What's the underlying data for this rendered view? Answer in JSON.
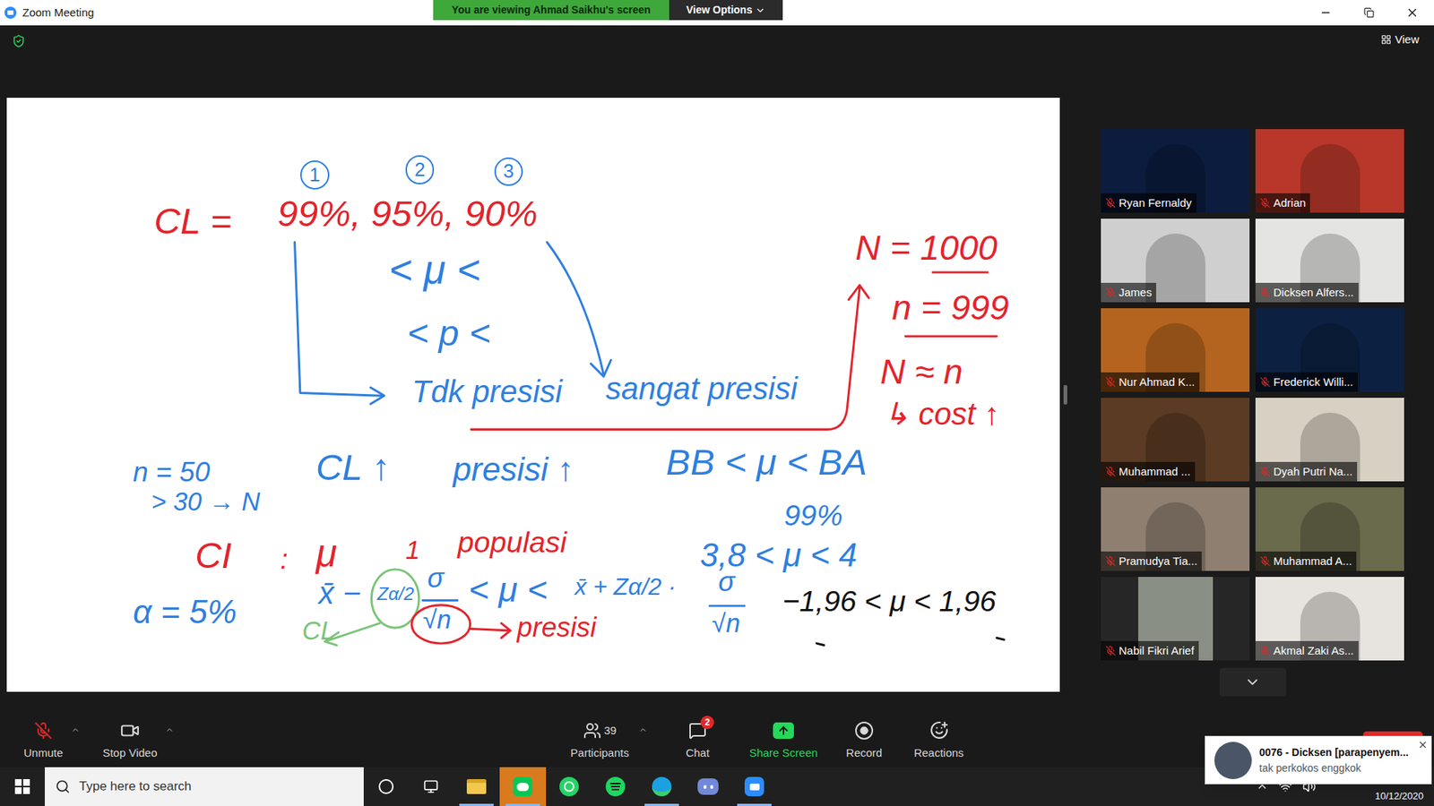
{
  "window": {
    "title": "Zoom Meeting"
  },
  "banner": {
    "text": "You are viewing Ahmad Saikhu's screen",
    "button": "View Options"
  },
  "view_button": "View",
  "whiteboard": {
    "notes": [
      {
        "text": "1",
        "color": "#2f7fe0",
        "kind": "circled"
      },
      {
        "text": "2",
        "color": "#2f7fe0",
        "kind": "circled"
      },
      {
        "text": "3",
        "color": "#2f7fe0",
        "kind": "circled"
      },
      {
        "text": "CL =",
        "color": "#e5232b",
        "kind": "plain"
      },
      {
        "text": "99%, 95%, 90%",
        "color": "#e5232b",
        "kind": "plain"
      },
      {
        "text": "< μ <",
        "color": "#2f7fe0",
        "kind": "plain"
      },
      {
        "text": "< p <",
        "color": "#2f7fe0",
        "kind": "plain"
      },
      {
        "text": "Tdk presisi",
        "color": "#2f7fe0",
        "kind": "plain"
      },
      {
        "text": "sangat presisi",
        "color": "#2f7fe0",
        "kind": "plain"
      },
      {
        "text": "N = 1000",
        "color": "#e5232b",
        "kind": "plain"
      },
      {
        "text": "n = 999",
        "color": "#e5232b",
        "kind": "plain"
      },
      {
        "text": "N ≈ n",
        "color": "#e5232b",
        "kind": "plain"
      },
      {
        "text": "↳ cost ↑",
        "color": "#e5232b",
        "kind": "plain"
      },
      {
        "text": "n = 50",
        "color": "#2f7fe0",
        "kind": "plain"
      },
      {
        "text": "> 30 → N",
        "color": "#2f7fe0",
        "kind": "plain"
      },
      {
        "text": "CL ↑",
        "color": "#2f7fe0",
        "kind": "plain"
      },
      {
        "text": "presisi ↑",
        "color": "#2f7fe0",
        "kind": "plain"
      },
      {
        "text": "BB < μ < BA",
        "color": "#2f7fe0",
        "kind": "plain"
      },
      {
        "text": "99%",
        "color": "#2f7fe0",
        "kind": "plain"
      },
      {
        "text": "3,8 < μ < 4",
        "color": "#2f7fe0",
        "kind": "plain"
      },
      {
        "text": "CI",
        "color": "#e5232b",
        "kind": "plain"
      },
      {
        "text": ":",
        "color": "#e5232b",
        "kind": "plain"
      },
      {
        "text": "μ",
        "color": "#e5232b",
        "kind": "plain"
      },
      {
        "text": "1",
        "color": "#e5232b",
        "kind": "plain"
      },
      {
        "text": "populasi",
        "color": "#e5232b",
        "kind": "plain"
      },
      {
        "text": "α = 5%",
        "color": "#2f7fe0",
        "kind": "plain"
      },
      {
        "text": "x̄ −",
        "color": "#2f7fe0",
        "kind": "plain"
      },
      {
        "text": "Zα/2",
        "color": "#2f7fe0",
        "kind": "plain"
      },
      {
        "text": "σ",
        "color": "#2f7fe0",
        "kind": "plain"
      },
      {
        "text": "√n",
        "color": "#2f7fe0",
        "kind": "plain"
      },
      {
        "text": "< μ <",
        "color": "#2f7fe0",
        "kind": "plain"
      },
      {
        "text": "x̄ + Zα/2 ·",
        "color": "#2f7fe0",
        "kind": "plain"
      },
      {
        "text": "σ",
        "color": "#2f7fe0",
        "kind": "plain"
      },
      {
        "text": "√n",
        "color": "#2f7fe0",
        "kind": "plain"
      },
      {
        "text": "CL",
        "color": "#7cc47a",
        "kind": "plain"
      },
      {
        "text": "presisi",
        "color": "#e5232b",
        "kind": "plain"
      },
      {
        "text": "−1,96 < μ < 1,96",
        "color": "#111111",
        "kind": "plain"
      }
    ]
  },
  "participants": [
    {
      "name": "Ryan Fernaldy",
      "muted": true,
      "color": "#0c1c3e",
      "kind": "video"
    },
    {
      "name": "Adrian",
      "muted": true,
      "color": "#b8372a",
      "kind": "video"
    },
    {
      "name": "James",
      "muted": true,
      "color": "#cfcfcf",
      "kind": "video"
    },
    {
      "name": "Dicksen Alfers...",
      "muted": true,
      "color": "#e4e4e2",
      "kind": "video"
    },
    {
      "name": "Nur Ahmad K...",
      "muted": true,
      "color": "#b5641f",
      "kind": "video"
    },
    {
      "name": "Frederick Willi...",
      "muted": true,
      "color": "#0c2142",
      "kind": "video"
    },
    {
      "name": "Muhammad ...",
      "muted": true,
      "color": "#5b3b24",
      "kind": "video"
    },
    {
      "name": "Dyah Putri Na...",
      "muted": true,
      "color": "#d8d0c2",
      "kind": "video"
    },
    {
      "name": "Pramudya Tia...",
      "muted": true,
      "color": "#8f7f70",
      "kind": "video"
    },
    {
      "name": "Muhammad A...",
      "muted": true,
      "color": "#6a6a4c",
      "kind": "video"
    },
    {
      "name": "Nabil Fikri Arief",
      "muted": true,
      "color": "#8a8f86",
      "kind": "avatar"
    },
    {
      "name": "Akmal Zaki As...",
      "muted": true,
      "color": "#e7e3de",
      "kind": "video"
    }
  ],
  "toolbar": {
    "items": [
      {
        "label": "Unmute",
        "kind": "mic",
        "caret": true
      },
      {
        "label": "Stop Video",
        "kind": "video",
        "caret": true
      },
      {
        "label": "Participants",
        "kind": "participants",
        "caret": true,
        "count": "39"
      },
      {
        "label": "Chat",
        "kind": "chat",
        "caret": false,
        "badge": "2"
      },
      {
        "label": "Share Screen",
        "kind": "share",
        "caret": false
      },
      {
        "label": "Record",
        "kind": "record",
        "caret": false
      },
      {
        "label": "Reactions",
        "kind": "reactions",
        "caret": false
      }
    ]
  },
  "notification": {
    "title": "0076 - Dicksen [parapenyem...",
    "message": "tak perkokos enggkok"
  },
  "taskbar": {
    "search_placeholder": "Type here to search",
    "date": "10/12/2020",
    "apps": [
      {
        "running": true,
        "flashing": false
      },
      {
        "running": true,
        "flashing": true
      },
      {
        "running": false,
        "flashing": false
      },
      {
        "running": false,
        "flashing": false
      },
      {
        "running": true,
        "flashing": false
      },
      {
        "running": false,
        "flashing": false
      },
      {
        "running": true,
        "flashing": false
      }
    ]
  }
}
